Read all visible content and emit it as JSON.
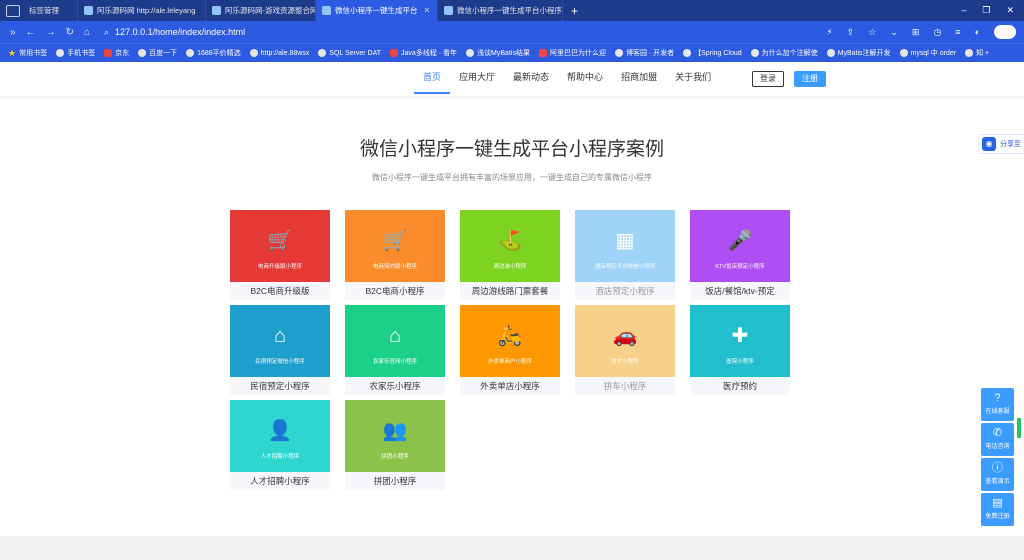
{
  "browser": {
    "tabs": [
      {
        "label": "标签管理"
      },
      {
        "label": "阿乐源码网 http://ale.leleyang"
      },
      {
        "label": "阿乐源码网-游戏资源整合网站,免"
      },
      {
        "label": "微信小程序一键生成平台"
      },
      {
        "label": "微信小程序一键生成平台小程序"
      }
    ],
    "new_tab": "+",
    "url": "127.0.0.1/home/index/index.html",
    "bookmarks": [
      "常用书签",
      "手机书签",
      "京东",
      "百度一下",
      "1688平价精选",
      "http://ale.88wsx",
      "SQL Server DAT",
      "Java多线程 · 看年",
      "浅谈MyBatis结果",
      "阿里巴巴为什么迎",
      "博客园 · 开发者",
      "【Spring Cloud",
      "为什么加个注解使",
      "MyBatis注解开发",
      "mysql 中 order",
      "知 +"
    ]
  },
  "nav": {
    "items": [
      "首页",
      "应用大厅",
      "最新动态",
      "帮助中心",
      "招商加盟",
      "关于我们"
    ],
    "login": "登录",
    "register": "注册"
  },
  "hero": {
    "title": "微信小程序一键生成平台小程序案例",
    "subtitle": "微信小程序一键生成平台拥有丰富的场景应用，一键生成自己的专属微信小程序"
  },
  "cases": [
    {
      "label": "B2C电商升级版",
      "caption": "电商升级版小程序",
      "color": "#e53935",
      "icon": "cart-icon"
    },
    {
      "label": "B2C电商小程序",
      "caption": "电商简约版小程序",
      "color": "#fb8c2b",
      "icon": "cart-icon"
    },
    {
      "label": "周边游线路门票套餐",
      "caption": "周边游小程序",
      "color": "#7ed321",
      "icon": "signpost-icon"
    },
    {
      "label": "酒店预定小程序",
      "caption": "酒店预定平台微信小程序",
      "color": "#9fd3f7",
      "icon": "building-icon"
    },
    {
      "label": "饭店/餐馆/ktv-预定",
      "caption": "KTV饭店预定小程序",
      "color": "#b04ef5",
      "icon": "microphone-icon"
    },
    {
      "label": "民宿预定小程序",
      "caption": "民宿预定微信小程序",
      "color": "#1e9ecb",
      "icon": "house-icon"
    },
    {
      "label": "农家乐小程序",
      "caption": "农家乐官网小程序",
      "color": "#1dd08a",
      "icon": "farmhouse-icon"
    },
    {
      "label": "外卖单店小程序",
      "caption": "外卖单商户小程序",
      "color": "#ff9800",
      "icon": "scooter-icon"
    },
    {
      "label": "拼车小程序",
      "caption": "拼车小程序",
      "color": "#f7d08a",
      "icon": "car-icon"
    },
    {
      "label": "医疗预约",
      "caption": "医院小程序",
      "color": "#22c0cf",
      "icon": "hospital-icon"
    },
    {
      "label": "人才招聘小程序",
      "caption": "人才招聘小程序",
      "color": "#2fd6cf",
      "icon": "person-icon"
    },
    {
      "label": "拼团小程序",
      "caption": "拼团小程序",
      "color": "#8bc34a",
      "icon": "group-icon"
    }
  ],
  "widgets": {
    "share": "分享至",
    "side": [
      "在线客服",
      "电话咨询",
      "查看演示",
      "免费注册"
    ]
  }
}
